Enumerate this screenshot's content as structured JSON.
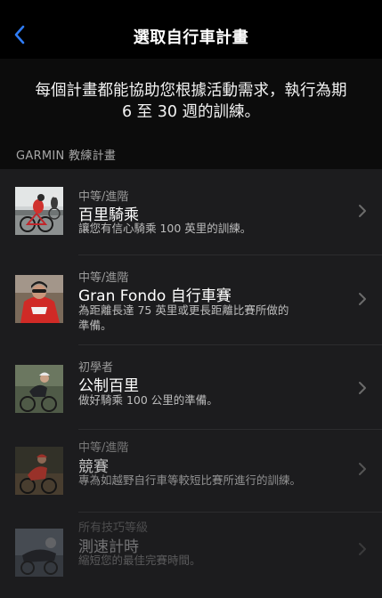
{
  "nav": {
    "title": "選取自行車計畫",
    "back_icon": "chevron-left-icon"
  },
  "intro": {
    "line1": "每個計畫都能協助您根據活動需求，執行為期",
    "line2": "6 至 30 週的訓練。"
  },
  "section": {
    "title": "GARMIN 教練計畫"
  },
  "colors": {
    "accent": "#2f7cf6",
    "background": "#0c0c0c",
    "list_background": "#1c1c1e",
    "secondary_text": "#9a9a9a"
  },
  "plans": [
    {
      "level": "中等/進階",
      "name": "百里騎乘",
      "desc1": "讓您有信心騎乘 100 英里的訓練。",
      "desc2": "",
      "thumb": "road-cyclists-photo"
    },
    {
      "level": "中等/進階",
      "name": "Gran Fondo 自行車賽",
      "desc1": "為距離長達 75 英里或更長距離比賽所做的",
      "desc2": "準備。",
      "thumb": "red-jersey-cyclist-photo"
    },
    {
      "level": "初學者",
      "name": "公制百里",
      "desc1": "做好騎乘 100 公里的準備。",
      "desc2": "",
      "thumb": "woman-cyclist-photo"
    },
    {
      "level": "中等/進階",
      "name": "競賽",
      "desc1": "專為如越野自行車等較短比賽所進行的訓練。",
      "desc2": "",
      "thumb": "mountain-biker-photo"
    },
    {
      "level": "所有技巧等級",
      "name": "測速計時",
      "desc1": "縮短您的最佳完賽時間。",
      "desc2": "",
      "thumb": "time-trial-cyclist-photo"
    }
  ]
}
